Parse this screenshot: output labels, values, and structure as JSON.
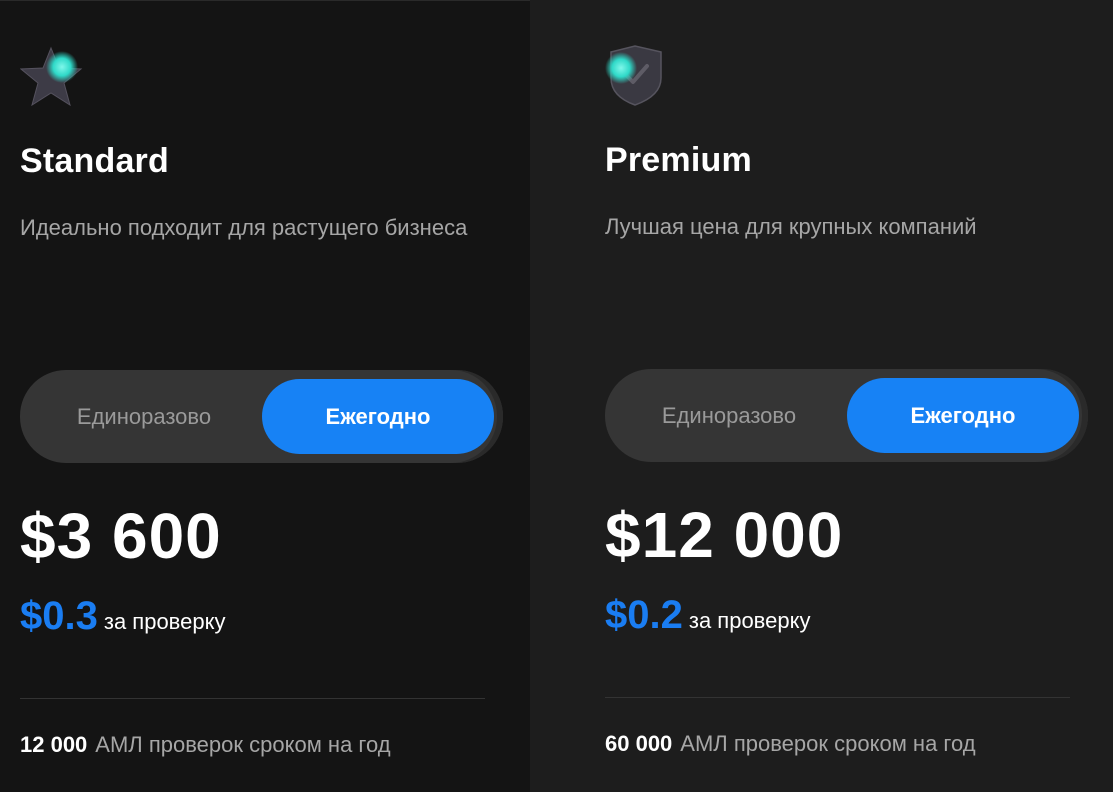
{
  "plans": [
    {
      "icon": "star-icon",
      "title": "Standard",
      "description": "Идеально подходит для растущего бизнеса",
      "toggle": {
        "once_label": "Единоразово",
        "yearly_label": "Ежегодно",
        "selected": "Ежегодно"
      },
      "price": "$3 600",
      "per_check_value": "$0.3",
      "per_check_text": "за проверку",
      "feature_count": "12 000",
      "feature_text": "АМЛ проверок сроком на год"
    },
    {
      "icon": "shield-check-icon",
      "title": "Premium",
      "description": "Лучшая цена для крупных компаний",
      "toggle": {
        "once_label": "Единоразово",
        "yearly_label": "Ежегодно",
        "selected": "Ежегодно"
      },
      "price": "$12 000",
      "per_check_value": "$0.2",
      "per_check_text": "за проверку",
      "feature_count": "60 000",
      "feature_text": "АМЛ проверок сроком на год"
    }
  ],
  "colors": {
    "accent_blue": "#1782f5",
    "price_blue": "#1a7df2",
    "icon_teal": "#3de0d0",
    "card_standard_bg": "#141414",
    "card_premium_bg": "#1d1d1d"
  }
}
